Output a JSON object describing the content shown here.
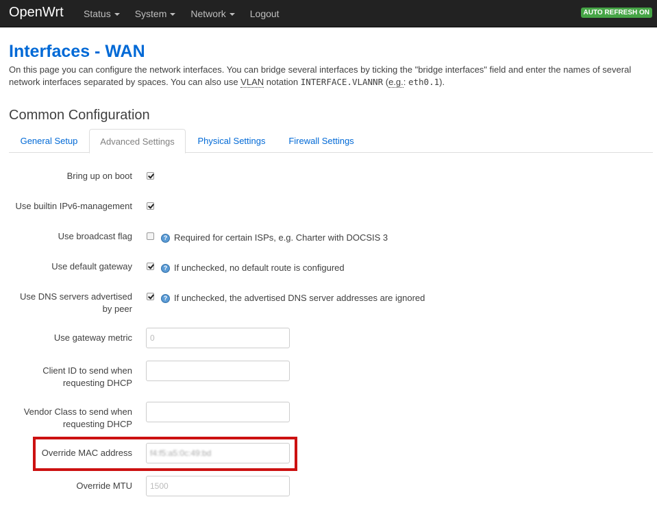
{
  "navbar": {
    "brand": "OpenWrt",
    "menu": [
      {
        "label": "Status"
      },
      {
        "label": "System"
      },
      {
        "label": "Network"
      },
      {
        "label": "Logout"
      }
    ],
    "auto_refresh": "AUTO REFRESH ON"
  },
  "page": {
    "title": "Interfaces - WAN",
    "desc_part1": "On this page you can configure the network interfaces. You can bridge several interfaces by ticking the \"bridge interfaces\" field and enter the names of several network interfaces separated by spaces. You can also use ",
    "desc_vlan": "VLAN",
    "desc_part2": " notation ",
    "desc_code1": "INTERFACE.VLANNR",
    "desc_part3": " (",
    "desc_eg": "e.g.",
    "desc_part4": ": ",
    "desc_code2": "eth0.1",
    "desc_part5": ")."
  },
  "section": {
    "title": "Common Configuration",
    "tabs": [
      {
        "label": "General Setup"
      },
      {
        "label": "Advanced Settings"
      },
      {
        "label": "Physical Settings"
      },
      {
        "label": "Firewall Settings"
      }
    ]
  },
  "fields": {
    "boot": {
      "label": "Bring up on boot",
      "checked": true
    },
    "ipv6": {
      "label": "Use builtin IPv6-management",
      "checked": true
    },
    "broadcast": {
      "label": "Use broadcast flag",
      "checked": false,
      "help": "Required for certain ISPs, e.g. Charter with DOCSIS 3"
    },
    "gateway": {
      "label": "Use default gateway",
      "checked": true,
      "help": "If unchecked, no default route is configured"
    },
    "dns": {
      "label": "Use DNS servers advertised by peer",
      "checked": true,
      "help": "If unchecked, the advertised DNS server addresses are ignored"
    },
    "metric": {
      "label": "Use gateway metric",
      "placeholder": "0"
    },
    "clientid": {
      "label": "Client ID to send when requesting DHCP",
      "value": ""
    },
    "vendor": {
      "label": "Vendor Class to send when requesting DHCP",
      "value": ""
    },
    "mac": {
      "label": "Override MAC address",
      "value": "f4:f5:a5:0c:49:bd"
    },
    "mtu": {
      "label": "Override MTU",
      "placeholder": "1500"
    }
  }
}
